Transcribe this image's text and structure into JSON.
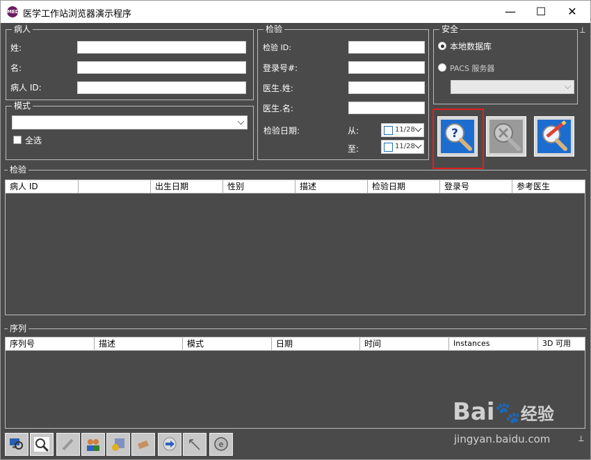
{
  "window": {
    "title": "医学工作站浏览器演示程序",
    "min": "—",
    "max": "☐",
    "close": "✕",
    "app_icon": "MED"
  },
  "patient": {
    "legend": "病人",
    "last_name_label": "姓:",
    "first_name_label": "名:",
    "id_label": "病人 ID:",
    "last_name": "",
    "first_name": "",
    "id": ""
  },
  "modality": {
    "legend": "模式",
    "value": "",
    "select_all_label": "全选"
  },
  "study": {
    "legend": "检验",
    "study_id_label": "检验 ID:",
    "accession_label": "登录号#:",
    "doctor_last_label": "医生.姓:",
    "doctor_first_label": "医生.名:",
    "date_label": "检验日期:",
    "from_label": "从:",
    "to_label": "至:",
    "from_date": "11/28",
    "to_date": "11/28"
  },
  "security": {
    "legend": "安全",
    "local_db_label": "本地数据库",
    "pacs_label": "PACS 服务器",
    "selected": "local"
  },
  "studies_table": {
    "legend": "检验",
    "columns": [
      "病人 ID",
      "",
      "出生日期",
      "性别",
      "描述",
      "检验日期",
      "登录号",
      "参考医生"
    ]
  },
  "series_table": {
    "legend": "序列",
    "columns": [
      "序列号",
      "描述",
      "模式",
      "日期",
      "时间",
      "Instances",
      "3D 可用"
    ]
  },
  "watermark": {
    "brand": "Bai",
    "brand2": "经验",
    "url": "jingyan.baidu.com"
  },
  "colors": {
    "accent_blue": "#1c6dd0",
    "highlight_red": "#e02020",
    "panel_bg": "#4a4a4a"
  }
}
